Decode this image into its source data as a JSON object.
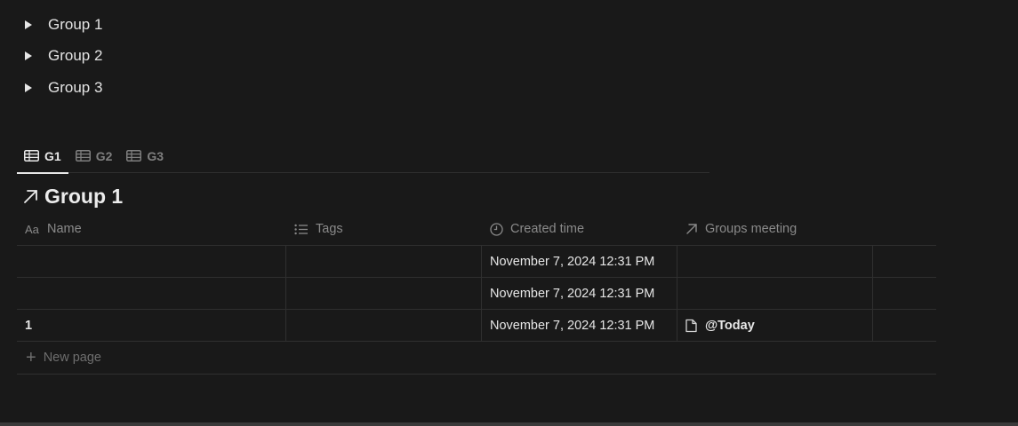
{
  "toggles": [
    {
      "label": "Group 1"
    },
    {
      "label": "Group 2"
    },
    {
      "label": "Group 3"
    }
  ],
  "tabs": [
    {
      "label": "G1",
      "icon": "table-icon",
      "active": true
    },
    {
      "label": "G2",
      "icon": "table-icon",
      "active": false
    },
    {
      "label": "G3",
      "icon": "table-icon",
      "active": false
    }
  ],
  "view": {
    "title": "Group 1",
    "icon": "arrow-up-right-icon"
  },
  "table": {
    "columns": [
      {
        "label": "Name",
        "icon": "text-aa-icon"
      },
      {
        "label": "Tags",
        "icon": "list-icon"
      },
      {
        "label": "Created time",
        "icon": "clock-icon"
      },
      {
        "label": "Groups meeting",
        "icon": "arrow-up-right-icon"
      }
    ],
    "rows": [
      {
        "name": "",
        "tags": "",
        "created": "November 7, 2024 12:31 PM",
        "groups": ""
      },
      {
        "name": "",
        "tags": "",
        "created": "November 7, 2024 12:31 PM",
        "groups": ""
      },
      {
        "name": "1",
        "tags": "",
        "created": "November 7, 2024 12:31 PM",
        "groups": "@Today"
      }
    ],
    "new_page": "New page"
  }
}
